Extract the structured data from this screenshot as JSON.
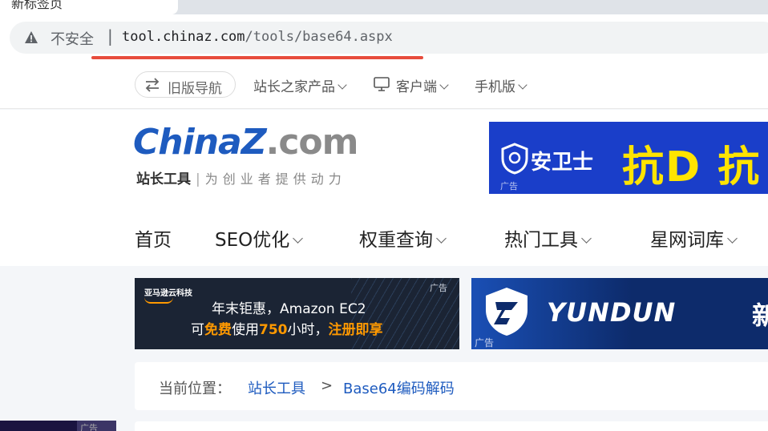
{
  "browser": {
    "tab_title": "新标签页",
    "security_label": "不安全",
    "separator": "|",
    "url_host": "tool.chinaz.com",
    "url_path": "/tools/base64.aspx"
  },
  "topnav": {
    "old_nav_label": "旧版导航",
    "links": [
      "站长之家产品",
      "客户端",
      "手机版"
    ]
  },
  "logo": {
    "word_main": "ChinaZ",
    "word_domain": ".com",
    "sub_brand": "站长工具",
    "sub_bar": "|",
    "slogan": "为创业者提供动力"
  },
  "ad_top": {
    "brand": "安卫士",
    "headline": "抗D 抗",
    "ad_tag": "广告"
  },
  "main_nav": [
    "首页",
    "SEO优化",
    "权重查询",
    "热门工具",
    "星网词库"
  ],
  "ad_aws": {
    "company": "亚马逊云科技",
    "line1": "年末钜惠，Amazon EC2",
    "line2_a": "可",
    "line2_b": "免费",
    "line2_c": "使用",
    "line2_d": "750",
    "line2_e": "小时，",
    "line2_f": "注册即享",
    "ad_tag": "广告"
  },
  "ad_yundun": {
    "name": "YUNDUN",
    "more": "新",
    "ad_tag": "广告"
  },
  "breadcrumb": {
    "label": "当前位置：",
    "root": "站长工具",
    "gt": ">",
    "current": "Base64编码解码"
  },
  "left_ad": {
    "ad_tag": "广告"
  },
  "colors": {
    "brand_blue": "#1e5bbf",
    "ad_yellow": "#ffe400",
    "aws_orange": "#ff9900",
    "warning_red": "#e74c3c"
  }
}
